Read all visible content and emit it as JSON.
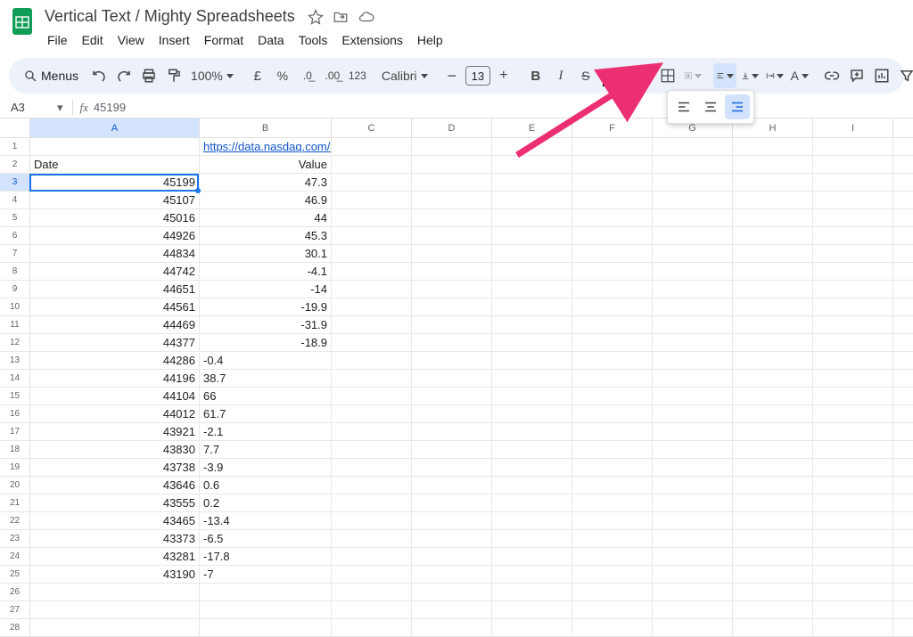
{
  "doc_title": "Vertical Text / Mighty Spreadsheets",
  "menus": [
    "File",
    "Edit",
    "View",
    "Insert",
    "Format",
    "Data",
    "Tools",
    "Extensions",
    "Help"
  ],
  "search_label": "Menus",
  "zoom": "100%",
  "font_name": "Calibri",
  "font_size": "13",
  "name_box": "A3",
  "formula": "45199",
  "columns": [
    "A",
    "B",
    "C",
    "D",
    "E",
    "F",
    "G",
    "H",
    "I"
  ],
  "link_b1": "https://data.nasdaq.com/ap",
  "header_a2": "Date",
  "header_b2": "Value",
  "rows": [
    {
      "a": "45199",
      "b": "47.3",
      "align": "right"
    },
    {
      "a": "45107",
      "b": "46.9",
      "align": "right"
    },
    {
      "a": "45016",
      "b": "44",
      "align": "right"
    },
    {
      "a": "44926",
      "b": "45.3",
      "align": "right"
    },
    {
      "a": "44834",
      "b": "30.1",
      "align": "right"
    },
    {
      "a": "44742",
      "b": "-4.1",
      "align": "right"
    },
    {
      "a": "44651",
      "b": "-14",
      "align": "right"
    },
    {
      "a": "44561",
      "b": "-19.9",
      "align": "right"
    },
    {
      "a": "44469",
      "b": "-31.9",
      "align": "right"
    },
    {
      "a": "44377",
      "b": "-18.9",
      "align": "right"
    },
    {
      "a": "44286",
      "b": "-0.4",
      "align": "left"
    },
    {
      "a": "44196",
      "b": "38.7",
      "align": "left"
    },
    {
      "a": "44104",
      "b": "66",
      "align": "left"
    },
    {
      "a": "44012",
      "b": "61.7",
      "align": "left"
    },
    {
      "a": "43921",
      "b": "-2.1",
      "align": "left"
    },
    {
      "a": "43830",
      "b": "7.7",
      "align": "left"
    },
    {
      "a": "43738",
      "b": "-3.9",
      "align": "left"
    },
    {
      "a": "43646",
      "b": "0.6",
      "align": "left"
    },
    {
      "a": "43555",
      "b": "0.2",
      "align": "left"
    },
    {
      "a": "43465",
      "b": "-13.4",
      "align": "left"
    },
    {
      "a": "43373",
      "b": "-6.5",
      "align": "left"
    },
    {
      "a": "43281",
      "b": "-17.8",
      "align": "left"
    },
    {
      "a": "43190",
      "b": "-7",
      "align": "left"
    }
  ],
  "format_123": "123",
  "selected_cell": "A3"
}
